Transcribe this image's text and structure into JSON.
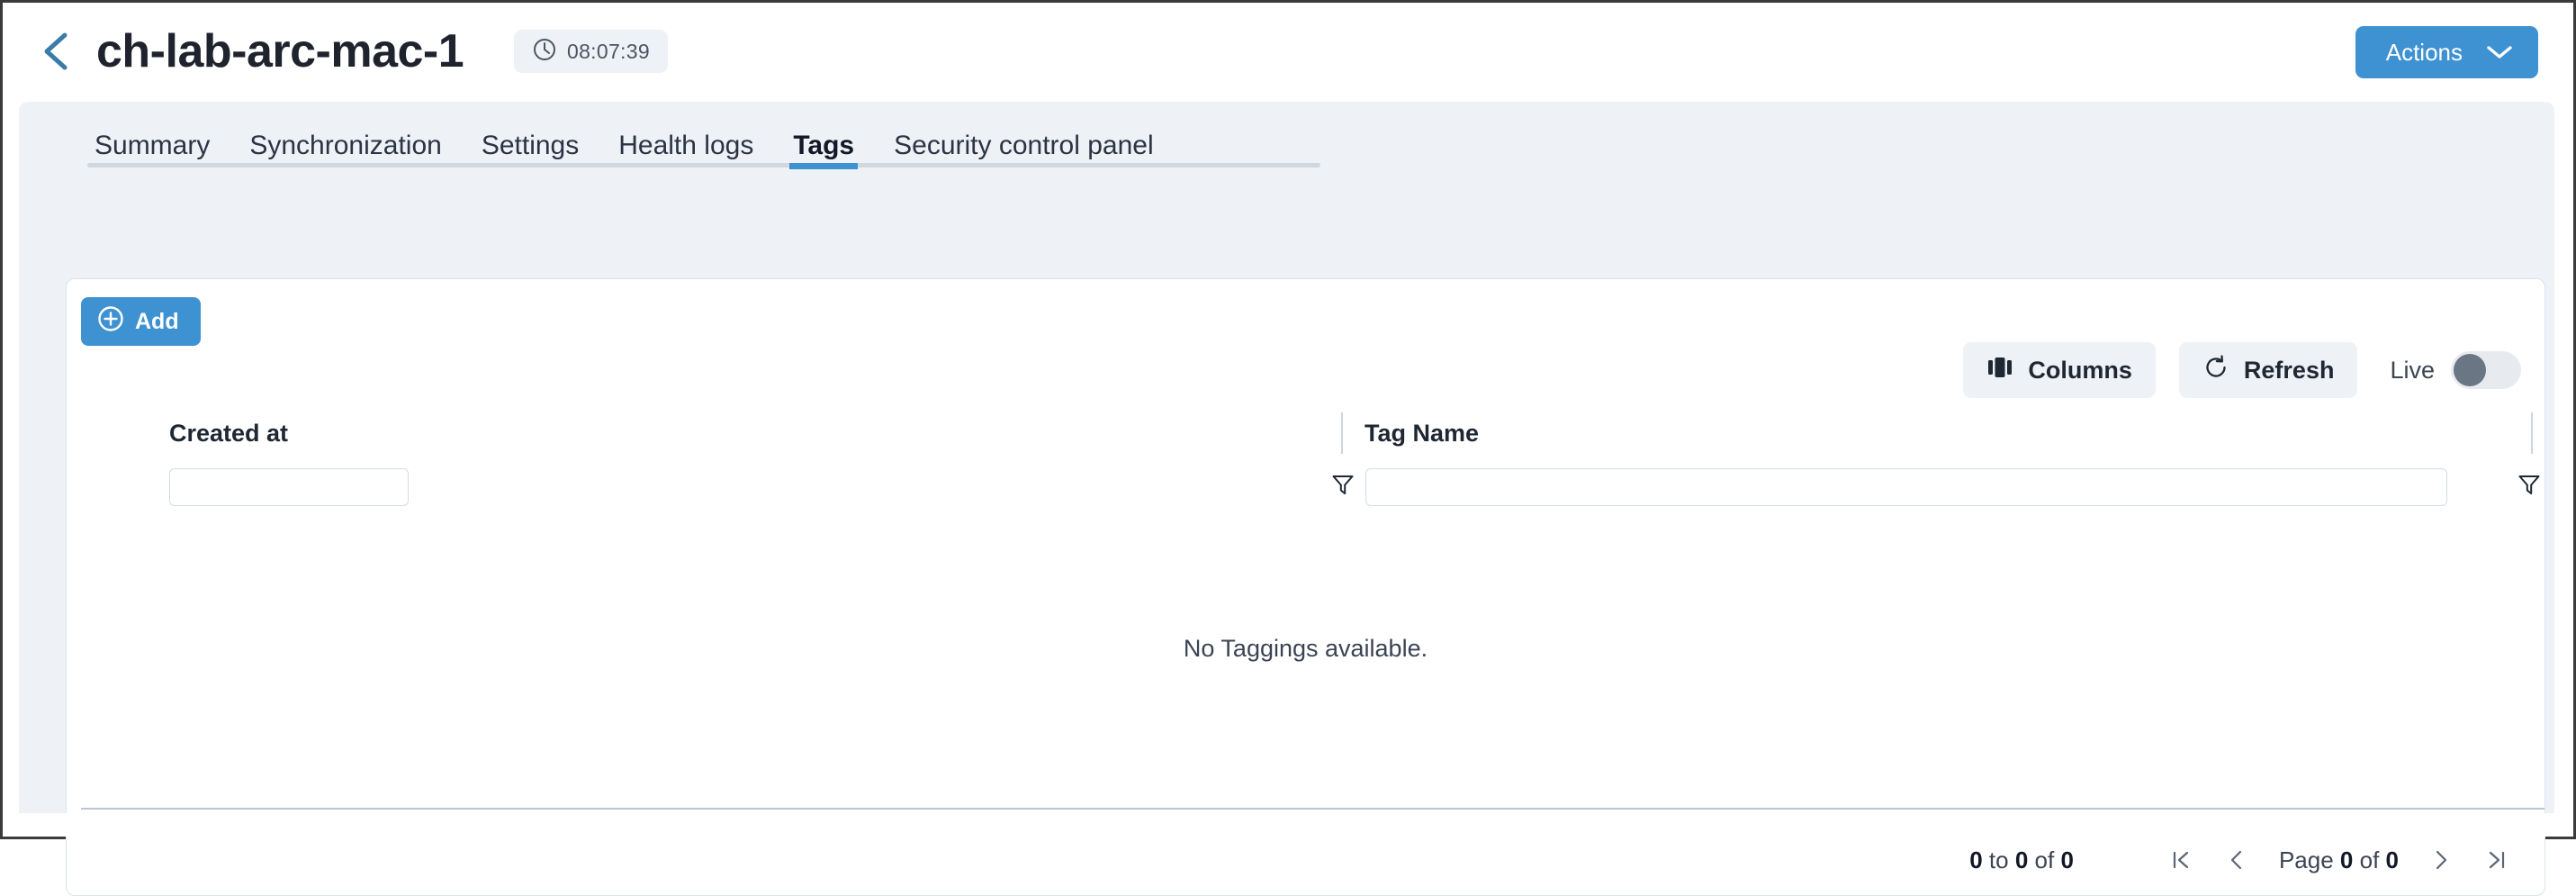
{
  "header": {
    "back_icon": "chevron-left-icon",
    "title": "ch-lab-arc-mac-1",
    "uptime_icon": "clock-icon",
    "uptime": "08:07:39",
    "actions_label": "Actions",
    "actions_caret_icon": "chevron-down-icon"
  },
  "tabs": [
    {
      "label": "Summary",
      "active": false
    },
    {
      "label": "Synchronization",
      "active": false
    },
    {
      "label": "Settings",
      "active": false
    },
    {
      "label": "Health logs",
      "active": false
    },
    {
      "label": "Tags",
      "active": true
    },
    {
      "label": "Security control panel",
      "active": false
    }
  ],
  "toolbar": {
    "add_label": "Add",
    "add_icon": "plus-circle-icon",
    "columns_label": "Columns",
    "columns_icon": "columns-icon",
    "refresh_label": "Refresh",
    "refresh_icon": "refresh-icon",
    "live_label": "Live",
    "live_enabled": false
  },
  "grid": {
    "columns": [
      {
        "title": "Created at",
        "filter_value": "",
        "filter_icon": "funnel-icon"
      },
      {
        "title": "Tag Name",
        "filter_value": "",
        "filter_icon": "funnel-icon"
      }
    ],
    "rows": [],
    "empty_message": "No Taggings available."
  },
  "pagination": {
    "range_prefix": "0",
    "range_to": "to",
    "range_middle": "0",
    "range_of": "of",
    "range_total": "0",
    "page_label": "Page",
    "page_current": "0",
    "page_of": "of",
    "page_total": "0",
    "first_icon": "first-page-icon",
    "prev_icon": "prev-page-icon",
    "next_icon": "next-page-icon",
    "last_icon": "last-page-icon"
  },
  "colors": {
    "accent": "#3f92d2",
    "panel": "#eef2f6",
    "text": "#1f2733",
    "border": "#dbe3ec"
  }
}
